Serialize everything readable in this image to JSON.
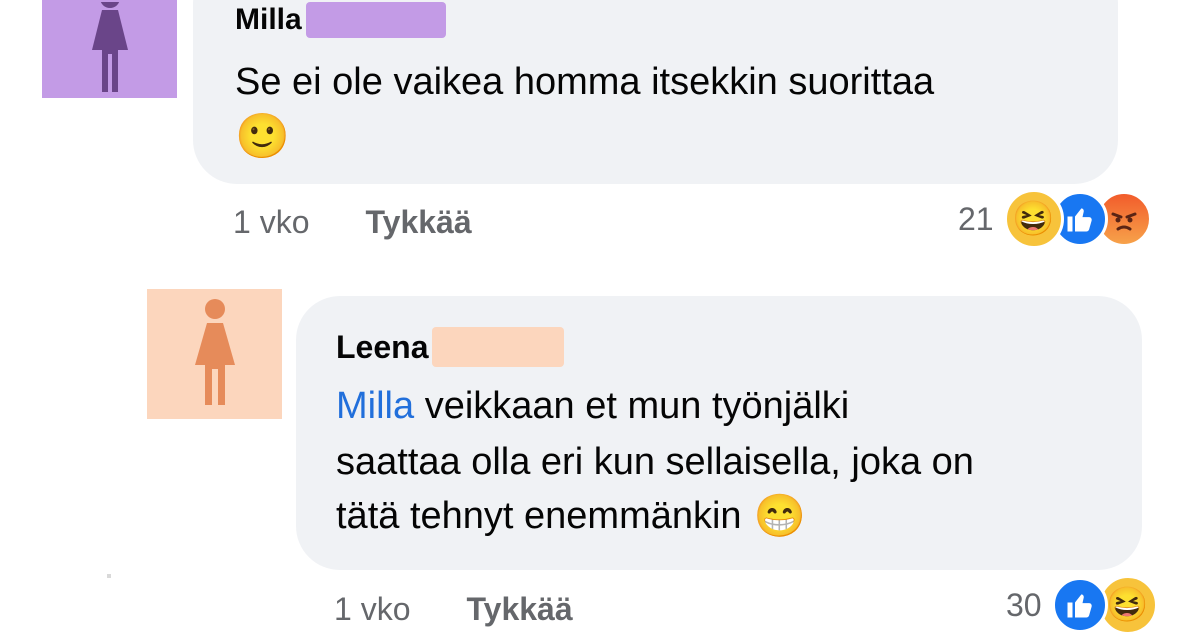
{
  "comments": [
    {
      "author": "Milla",
      "text": "Se ei ole vaikea homma itsekkin suorittaa",
      "emoji": "🙂",
      "time": "1 vko",
      "like_label": "Tykkää",
      "reaction_count": "21",
      "reactions": [
        "haha-icon",
        "like-icon",
        "angry-icon"
      ],
      "avatar_color": "#c39be6",
      "redact_color": "#c39be6"
    },
    {
      "author": "Leena",
      "mention": "Milla",
      "text_line1": "veikkaan et mun työnjälki",
      "text_line2": "saattaa olla eri kun sellaisella, joka on",
      "text_line3": "tätä tehnyt enemmänkin",
      "emoji": "😁",
      "time": "1 vko",
      "like_label": "Tykkää",
      "reaction_count": "30",
      "reactions": [
        "like-icon",
        "haha-icon"
      ],
      "avatar_color": "#fcd6bd",
      "redact_color": "#fcd6bd"
    }
  ]
}
